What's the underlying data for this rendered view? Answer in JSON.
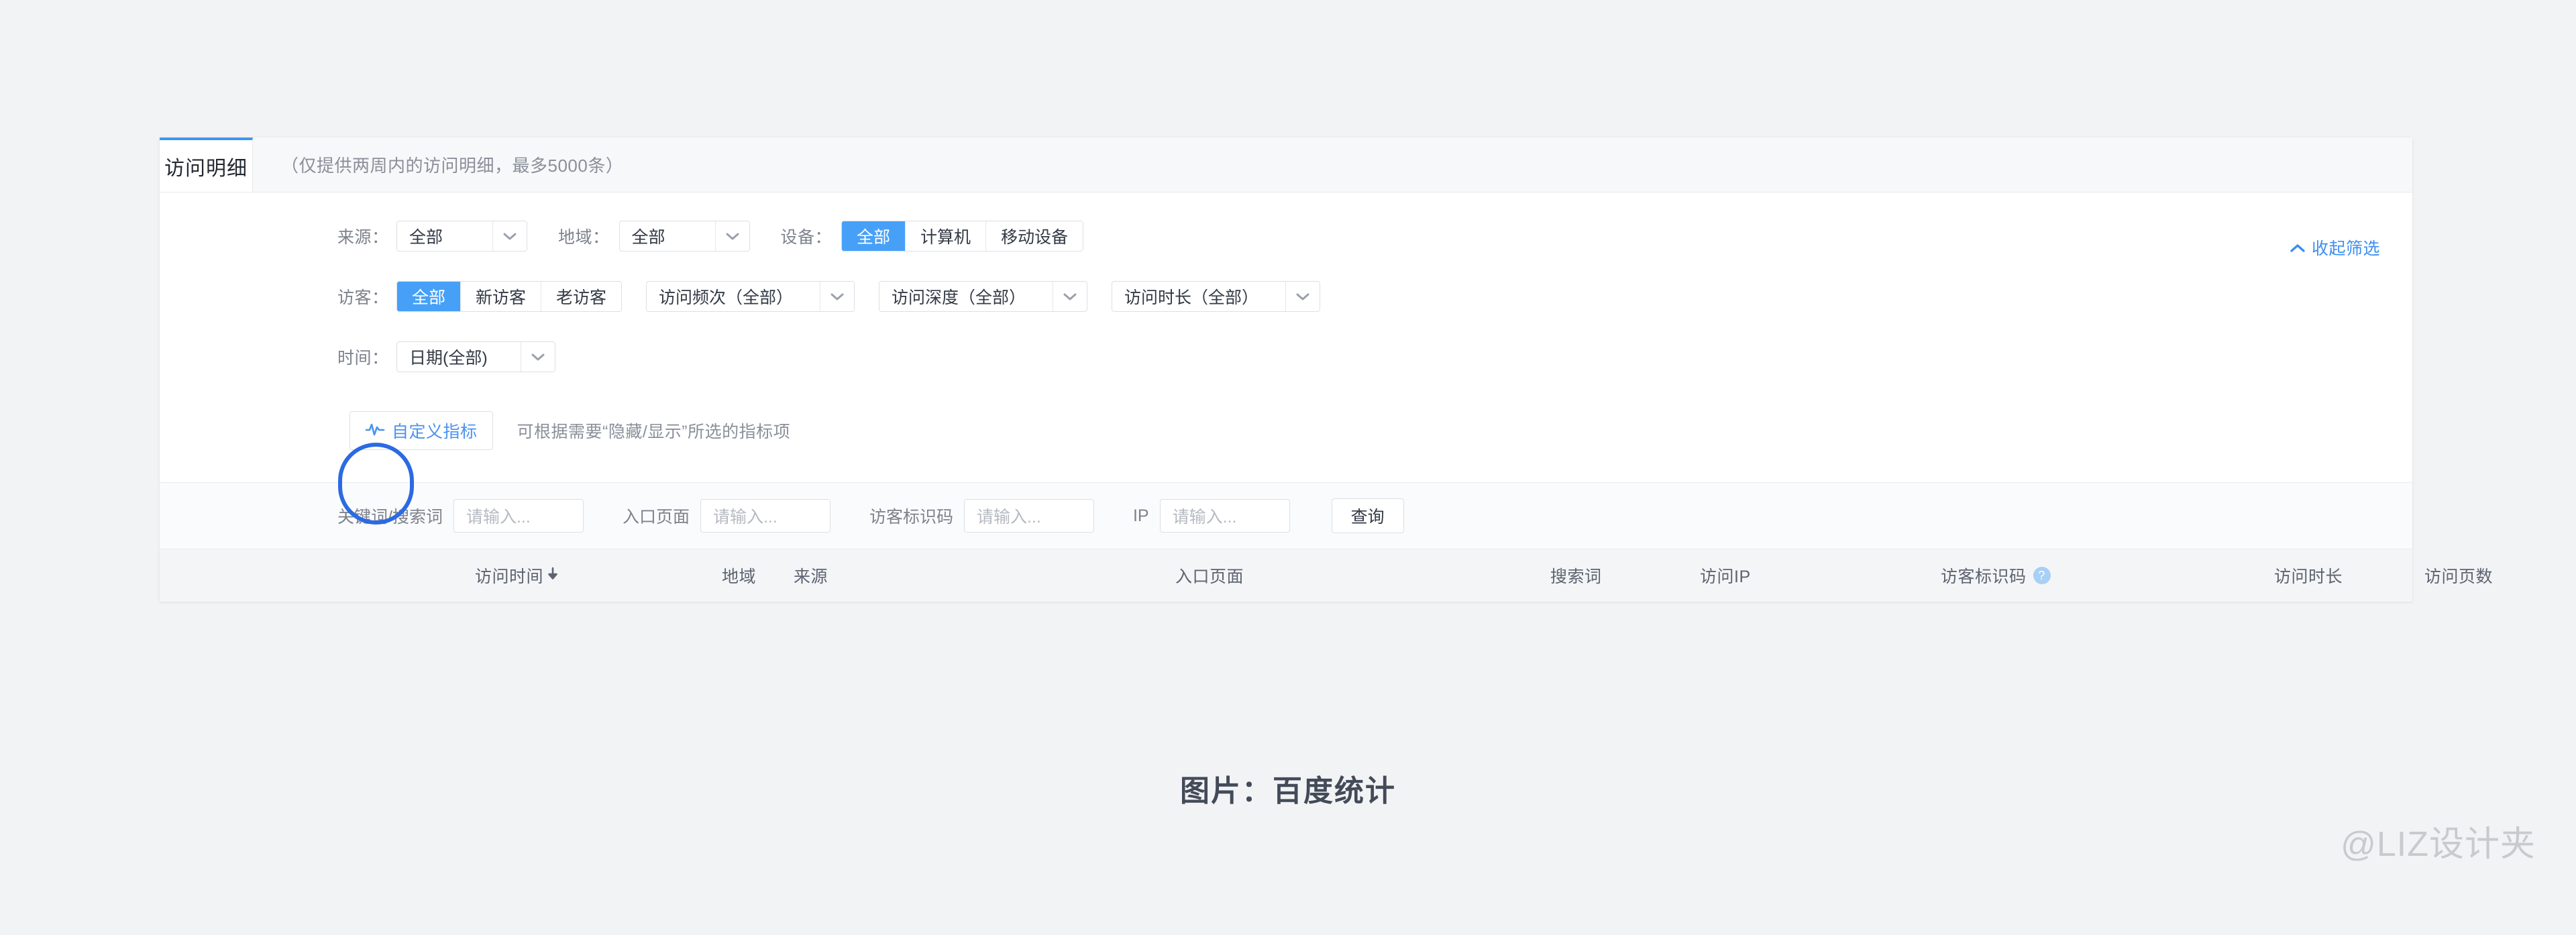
{
  "tab": {
    "label": "访问明细",
    "note": "（仅提供两周内的访问明细，最多5000条）"
  },
  "filters": {
    "collapse_link": "收起筛选",
    "row_source": {
      "label": "来源：",
      "source_value": "全部",
      "area_label": "地域：",
      "area_value": "全部",
      "device_label": "设备：",
      "device_options": [
        "全部",
        "计算机",
        "移动设备"
      ],
      "device_selected": "全部"
    },
    "row_visitor": {
      "label": "访客：",
      "visitor_options": [
        "全部",
        "新访客",
        "老访客"
      ],
      "visitor_selected": "全部",
      "frequency_value": "访问频次（全部）",
      "depth_value": "访问深度（全部）",
      "duration_value": "访问时长（全部）"
    },
    "row_time": {
      "label": "时间：",
      "date_value": "日期(全部)"
    }
  },
  "metrics": {
    "button_label": "自定义指标",
    "hint": "可根据需要“隐藏/显示”所选的指标项"
  },
  "search": {
    "keyword_label": "关键词/搜索词",
    "keyword_placeholder": "请输入...",
    "entry_page_label": "入口页面",
    "entry_page_placeholder": "请输入...",
    "visitor_id_label": "访客标识码",
    "visitor_id_placeholder": "请输入...",
    "ip_label": "IP",
    "ip_placeholder": "请输入...",
    "query_button": "查询"
  },
  "table": {
    "columns": [
      {
        "label": "访问时间",
        "sortable": true
      },
      {
        "label": "地域",
        "sortable": false
      },
      {
        "label": "来源",
        "sortable": false
      },
      {
        "label": "入口页面",
        "sortable": false
      },
      {
        "label": "搜索词",
        "sortable": false
      },
      {
        "label": "访问IP",
        "sortable": false
      },
      {
        "label": "访客标识码",
        "sortable": false,
        "help": "?"
      },
      {
        "label": "访问时长",
        "sortable": false
      },
      {
        "label": "访问页数",
        "sortable": false
      }
    ]
  },
  "caption": "图片：百度统计",
  "watermark": "@LIZ设计夹",
  "colors": {
    "accent_blue": "#46a0f8",
    "link_blue": "#3c8ef0",
    "annotation_blue": "#2b6ae3",
    "page_bg": "#f2f3f5"
  }
}
